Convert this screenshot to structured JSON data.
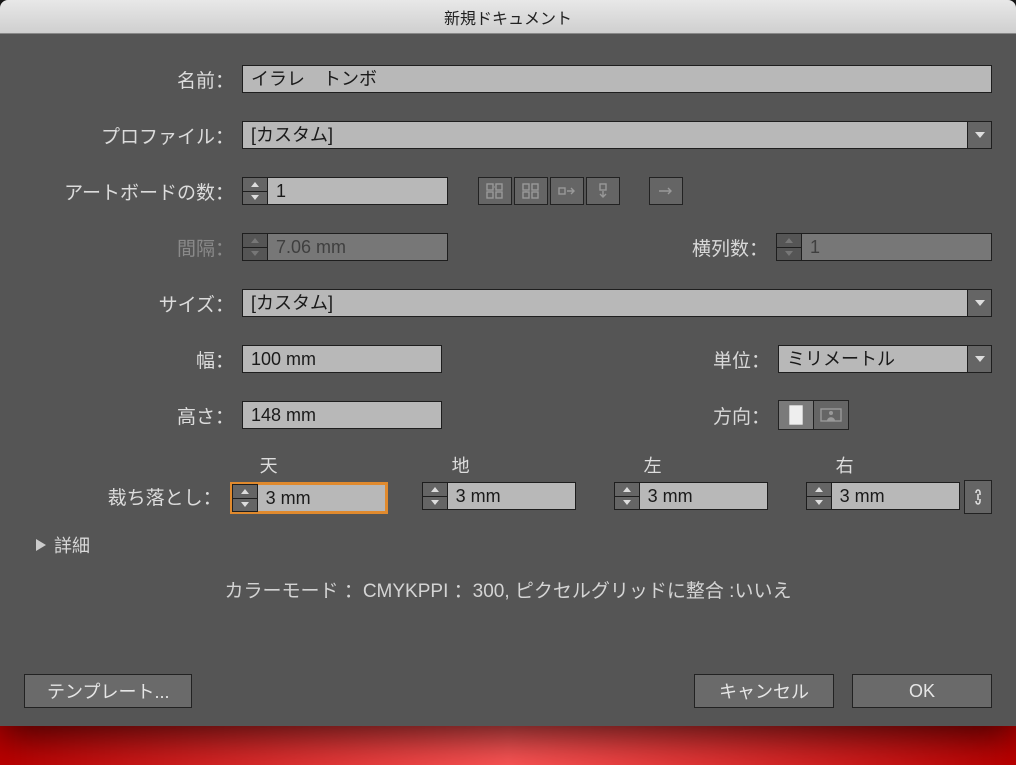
{
  "title": "新規ドキュメント",
  "labels": {
    "name": "名前：",
    "profile": "プロファイル：",
    "artboards": "アートボードの数：",
    "spacing": "間隔：",
    "rows": "横列数：",
    "size": "サイズ：",
    "width": "幅：",
    "units": "単位：",
    "height": "高さ：",
    "orientation": "方向：",
    "bleed": "裁ち落とし：",
    "top": "天",
    "bottom": "地",
    "left": "左",
    "right": "右",
    "advanced": "詳細"
  },
  "values": {
    "name": "イラレ　トンボ",
    "profile": "[カスタム]",
    "artboards": "1",
    "spacing": "7.06 mm",
    "rows": "1",
    "size": "[カスタム]",
    "width": "100 mm",
    "height": "148 mm",
    "units": "ミリメートル",
    "bleed_top": "3 mm",
    "bleed_bottom": "3 mm",
    "bleed_left": "3 mm",
    "bleed_right": "3 mm"
  },
  "summary": "カラーモード ：CMYKPPI ：300, ピクセルグリッドに整合 :いいえ",
  "buttons": {
    "template": "テンプレート...",
    "cancel": "キャンセル",
    "ok": "OK"
  }
}
